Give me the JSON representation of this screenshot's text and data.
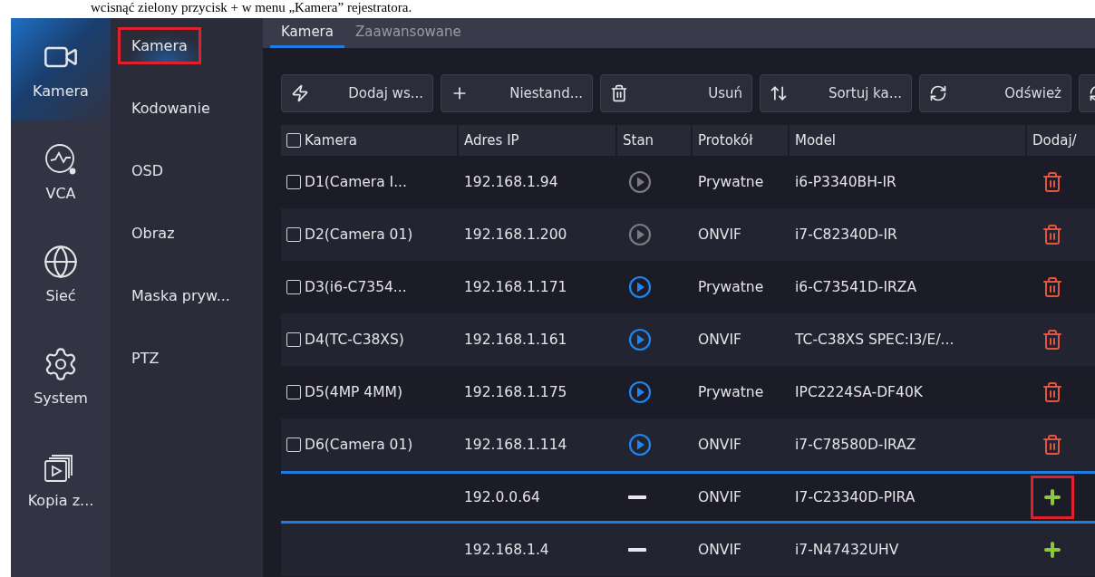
{
  "caption": "wcisnąć zielony przycisk + w menu „Kamera” rejestratora.",
  "sidebar": {
    "items": [
      {
        "label": "Kamera",
        "selected": true
      },
      {
        "label": "VCA",
        "selected": false
      },
      {
        "label": "Sieć",
        "selected": false
      },
      {
        "label": "System",
        "selected": false
      },
      {
        "label": "Kopia z...",
        "selected": false
      }
    ]
  },
  "submenu": {
    "items": [
      {
        "label": "Kamera",
        "selected": true,
        "highlighted": true
      },
      {
        "label": "Kodowanie",
        "selected": false,
        "highlighted": false
      },
      {
        "label": "OSD",
        "selected": false,
        "highlighted": false
      },
      {
        "label": "Obraz",
        "selected": false,
        "highlighted": false
      },
      {
        "label": "Maska pryw...",
        "selected": false,
        "highlighted": false
      },
      {
        "label": "PTZ",
        "selected": false,
        "highlighted": false
      }
    ]
  },
  "tabs": [
    {
      "label": "Kamera",
      "selected": true
    },
    {
      "label": "Zaawansowane",
      "selected": false
    }
  ],
  "toolbar": [
    {
      "label": "Dodaj ws..."
    },
    {
      "label": "Niestand..."
    },
    {
      "label": "Usuń"
    },
    {
      "label": "Sortuj ka..."
    },
    {
      "label": "Odśwież"
    }
  ],
  "table": {
    "columns": [
      "Kamera",
      "Adres IP",
      "Stan",
      "Protokół",
      "Model",
      "Dodaj/"
    ],
    "header_checked": false,
    "rows": [
      {
        "kind": "added",
        "checked": false,
        "camera": "D1(Camera I...",
        "ip": "192.168.1.94",
        "online": false,
        "protocol": "Prywatne",
        "model": "i6-P3340BH-IR",
        "selected": false,
        "highlighted": false
      },
      {
        "kind": "added",
        "checked": false,
        "camera": "D2(Camera 01)",
        "ip": "192.168.1.200",
        "online": false,
        "protocol": "ONVIF",
        "model": "i7-C82340D-IR",
        "selected": false,
        "highlighted": false
      },
      {
        "kind": "added",
        "checked": false,
        "camera": "D3(i6-C7354...",
        "ip": "192.168.1.171",
        "online": true,
        "protocol": "Prywatne",
        "model": "i6-C73541D-IRZA",
        "selected": false,
        "highlighted": false
      },
      {
        "kind": "added",
        "checked": false,
        "camera": "D4(TC-C38XS)",
        "ip": "192.168.1.161",
        "online": true,
        "protocol": "ONVIF",
        "model": "TC-C38XS SPEC:I3/E/...",
        "selected": false,
        "highlighted": false
      },
      {
        "kind": "added",
        "checked": false,
        "camera": "D5(4MP 4MM)",
        "ip": "192.168.1.175",
        "online": true,
        "protocol": "Prywatne",
        "model": "IPC2224SA-DF40K",
        "selected": false,
        "highlighted": false
      },
      {
        "kind": "added",
        "checked": false,
        "camera": "D6(Camera 01)",
        "ip": "192.168.1.114",
        "online": true,
        "protocol": "ONVIF",
        "model": "i7-C78580D-IRAZ",
        "selected": false,
        "highlighted": false
      },
      {
        "kind": "discovered",
        "ip": "192.0.0.64",
        "protocol": "ONVIF",
        "model": "I7-C23340D-PIRA",
        "selected": true,
        "highlighted": true
      },
      {
        "kind": "discovered",
        "ip": "192.168.1.4",
        "protocol": "ONVIF",
        "model": "i7-N47432UHV",
        "selected": false,
        "highlighted": false
      }
    ]
  }
}
